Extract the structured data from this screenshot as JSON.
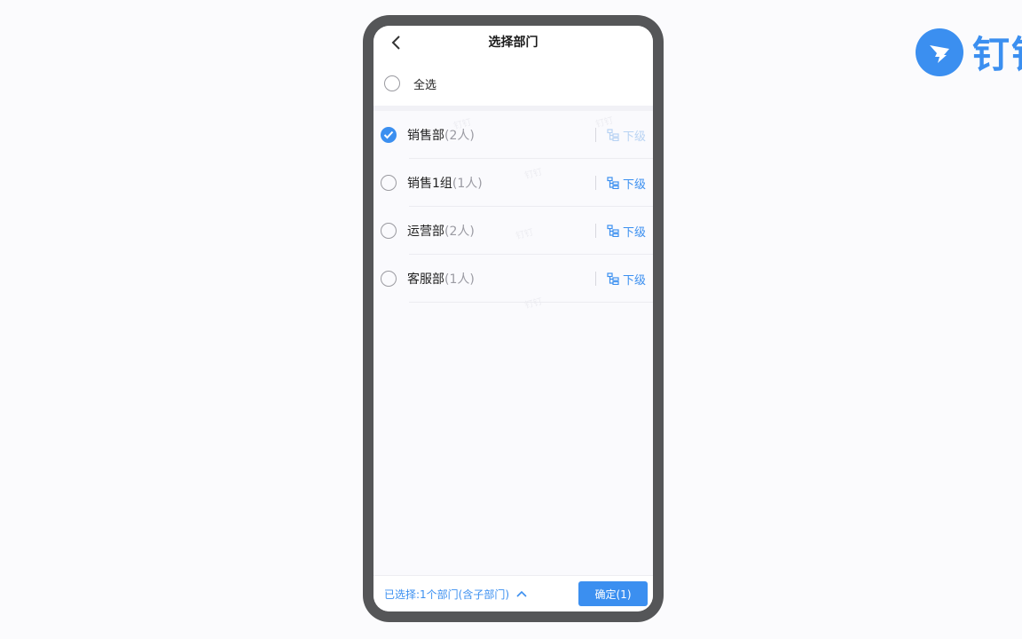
{
  "brand": {
    "text": "钉钉",
    "color": "#3b8ff0"
  },
  "header": {
    "title": "选择部门",
    "back_icon": "chevron-left-icon"
  },
  "select_all": {
    "label": "全选",
    "checked": false
  },
  "departments": [
    {
      "name": "销售部",
      "count": "(2人)",
      "checked": true,
      "sub_label": "下级",
      "sub_enabled": false
    },
    {
      "name": "销售1组",
      "count": "(1人)",
      "checked": false,
      "sub_label": "下级",
      "sub_enabled": true
    },
    {
      "name": "运营部",
      "count": "(2人)",
      "checked": false,
      "sub_label": "下级",
      "sub_enabled": true
    },
    {
      "name": "客服部",
      "count": "(1人)",
      "checked": false,
      "sub_label": "下级",
      "sub_enabled": true
    }
  ],
  "footer": {
    "summary": "已选择:1个部门(含子部门)",
    "expand_icon": "chevron-up-icon",
    "confirm_label": "确定(1)"
  },
  "colors": {
    "accent": "#3b8ff0",
    "phone_frame": "#555658"
  }
}
